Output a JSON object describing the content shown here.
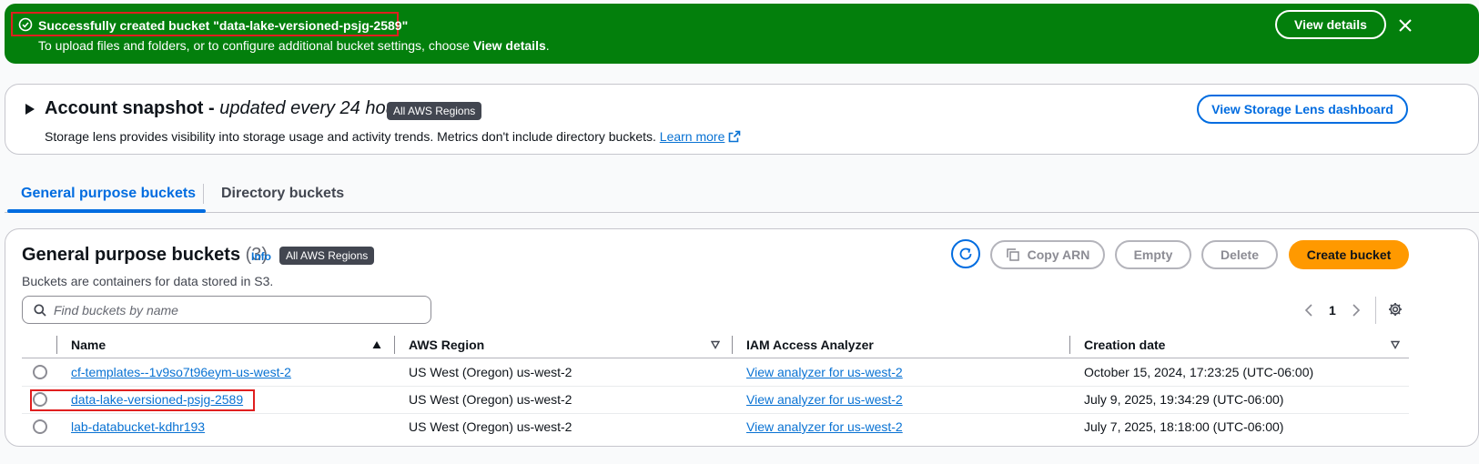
{
  "flash": {
    "title": "Successfully created bucket \"data-lake-versioned-psjg-2589\"",
    "subtitle_prefix": "To upload files and folders, or to configure additional bucket settings, choose ",
    "subtitle_bold": "View details",
    "subtitle_suffix": ".",
    "view_details_label": "View details"
  },
  "snapshot": {
    "title": "Account snapshot -",
    "title_italic": "updated every 24 hours",
    "badge": "All AWS Regions",
    "description": "Storage lens provides visibility into storage usage and activity trends. Metrics don't include directory buckets.",
    "learn_more": "Learn more",
    "dashboard_button": "View Storage Lens dashboard"
  },
  "tabs": [
    {
      "label": "General purpose buckets",
      "active": true
    },
    {
      "label": "Directory buckets",
      "active": false
    }
  ],
  "buckets": {
    "title": "General purpose buckets",
    "count": "(3)",
    "info": "Info",
    "badge": "All AWS Regions",
    "description": "Buckets are containers for data stored in S3.",
    "actions": {
      "copy_arn": "Copy ARN",
      "empty": "Empty",
      "delete": "Delete",
      "create": "Create bucket"
    },
    "search_placeholder": "Find buckets by name",
    "page": "1",
    "columns": [
      "Name",
      "AWS Region",
      "IAM Access Analyzer",
      "Creation date"
    ],
    "rows": [
      {
        "name": "cf-templates--1v9so7t96eym-us-west-2",
        "region": "US West (Oregon) us-west-2",
        "iam": "View analyzer for us-west-2",
        "date": "October 15, 2024, 17:23:25 (UTC-06:00)"
      },
      {
        "name": "data-lake-versioned-psjg-2589",
        "region": "US West (Oregon) us-west-2",
        "iam": "View analyzer for us-west-2",
        "date": "July 9, 2025, 19:34:29 (UTC-06:00)"
      },
      {
        "name": "lab-databucket-kdhr193",
        "region": "US West (Oregon) us-west-2",
        "iam": "View analyzer for us-west-2",
        "date": "July 7, 2025, 18:18:00 (UTC-06:00)"
      }
    ]
  },
  "colors": {
    "success": "#037f0c",
    "primary_blue": "#006ce0",
    "link_blue": "#0972d3",
    "create_orange": "#ff9900",
    "highlight_red": "#e01f1f"
  }
}
